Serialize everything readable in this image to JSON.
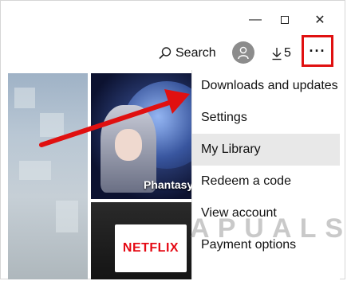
{
  "window": {
    "minimize_glyph": "—",
    "close_glyph": "✕"
  },
  "toolbar": {
    "search_label": "Search",
    "downloads_count": "5",
    "more_glyph": "···",
    "search_icon": "search-icon",
    "account_icon": "account-icon",
    "download_icon": "download-icon"
  },
  "tiles": {
    "game_title": "Phantasy",
    "netflix_label": "NETFLIX"
  },
  "menu": {
    "items": [
      {
        "label": "Downloads and updates"
      },
      {
        "label": "Settings"
      },
      {
        "label": "My Library"
      },
      {
        "label": "Redeem a code"
      },
      {
        "label": "View account"
      },
      {
        "label": "Payment options"
      }
    ],
    "active_index": 2
  },
  "overlay": {
    "highlight_color": "#e01010",
    "arrow_color": "#e01010",
    "watermark": "APPUALS"
  }
}
